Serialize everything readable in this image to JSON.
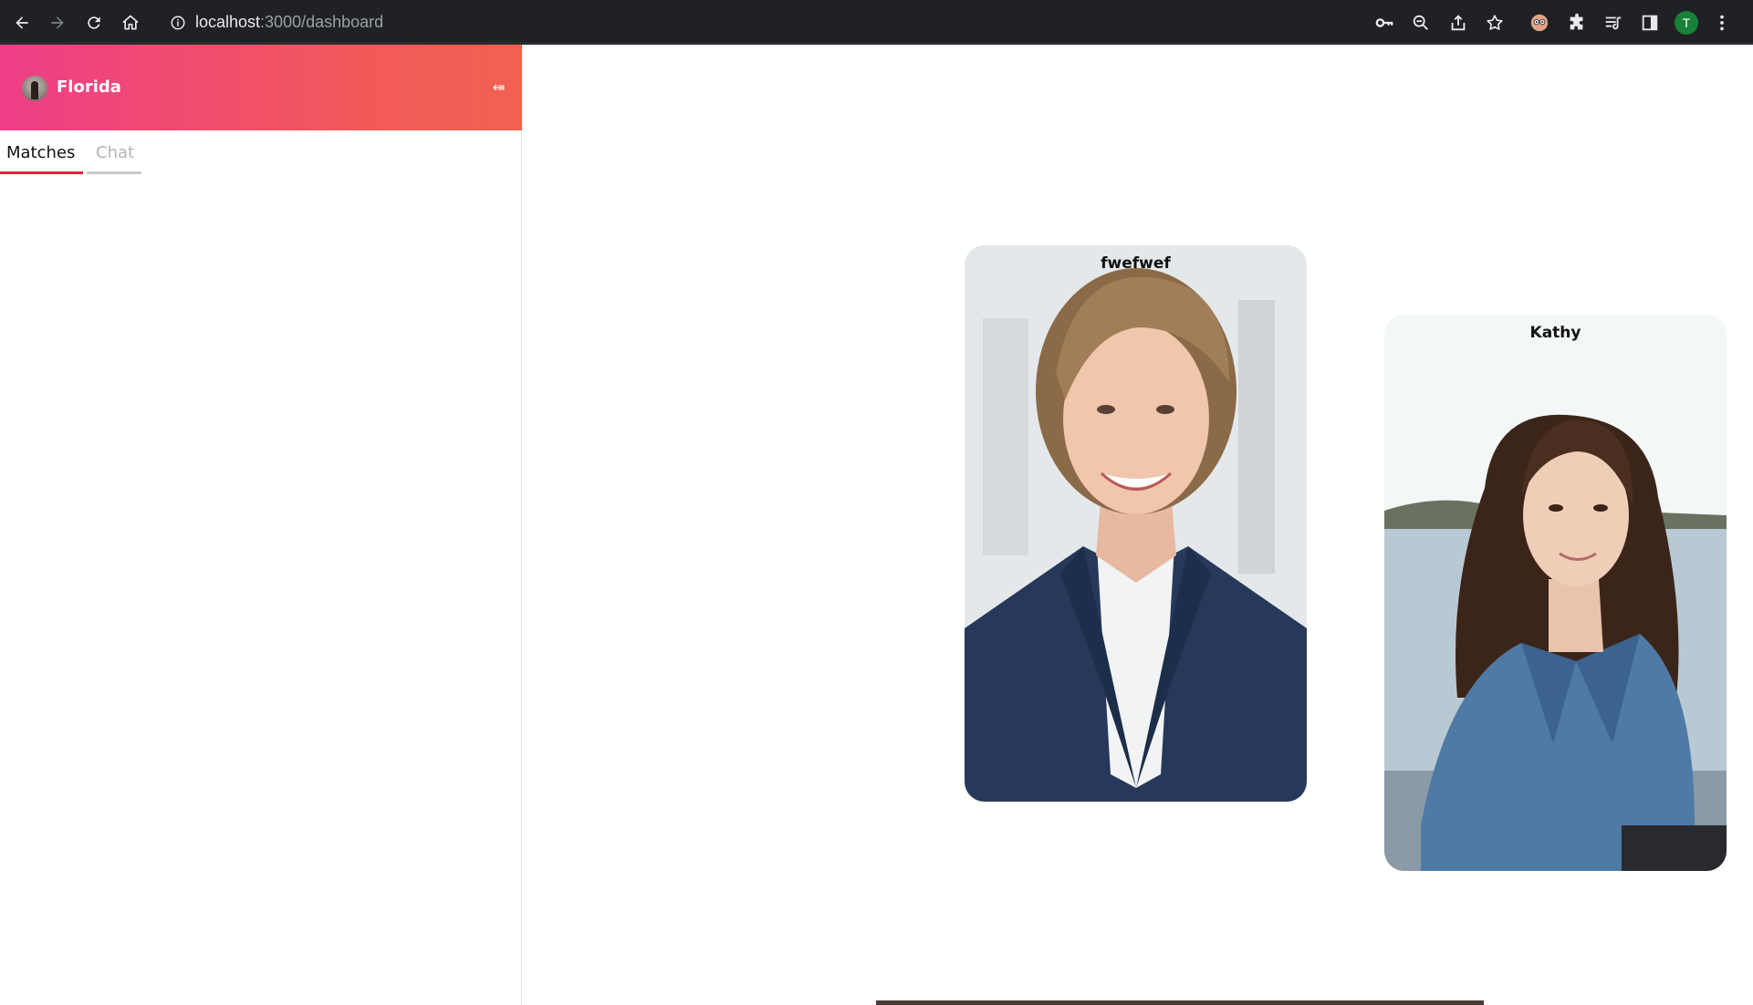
{
  "browser": {
    "url_host": "localhost",
    "url_path": ":3000/dashboard",
    "profile_initial": "T",
    "icons": [
      "back-icon",
      "forward-icon",
      "reload-icon",
      "home-icon",
      "info-icon",
      "key-icon",
      "zoom-icon",
      "share-icon",
      "star-icon",
      "extension-avatar-icon",
      "puzzle-icon",
      "media-icon",
      "sidepanel-icon",
      "more-icon"
    ]
  },
  "sidebar": {
    "user_name": "Florida",
    "tabs": [
      {
        "label": "Matches",
        "active": true
      },
      {
        "label": "Chat",
        "active": false
      }
    ]
  },
  "cards": [
    {
      "name": "fwefwef"
    },
    {
      "name": "Kathy"
    }
  ],
  "colors": {
    "header_gradient_start": "#ee3e87",
    "header_gradient_end": "#f26150",
    "active_tab_underline": "#e0243a",
    "inactive_tab_underline": "#c9c9c9"
  }
}
